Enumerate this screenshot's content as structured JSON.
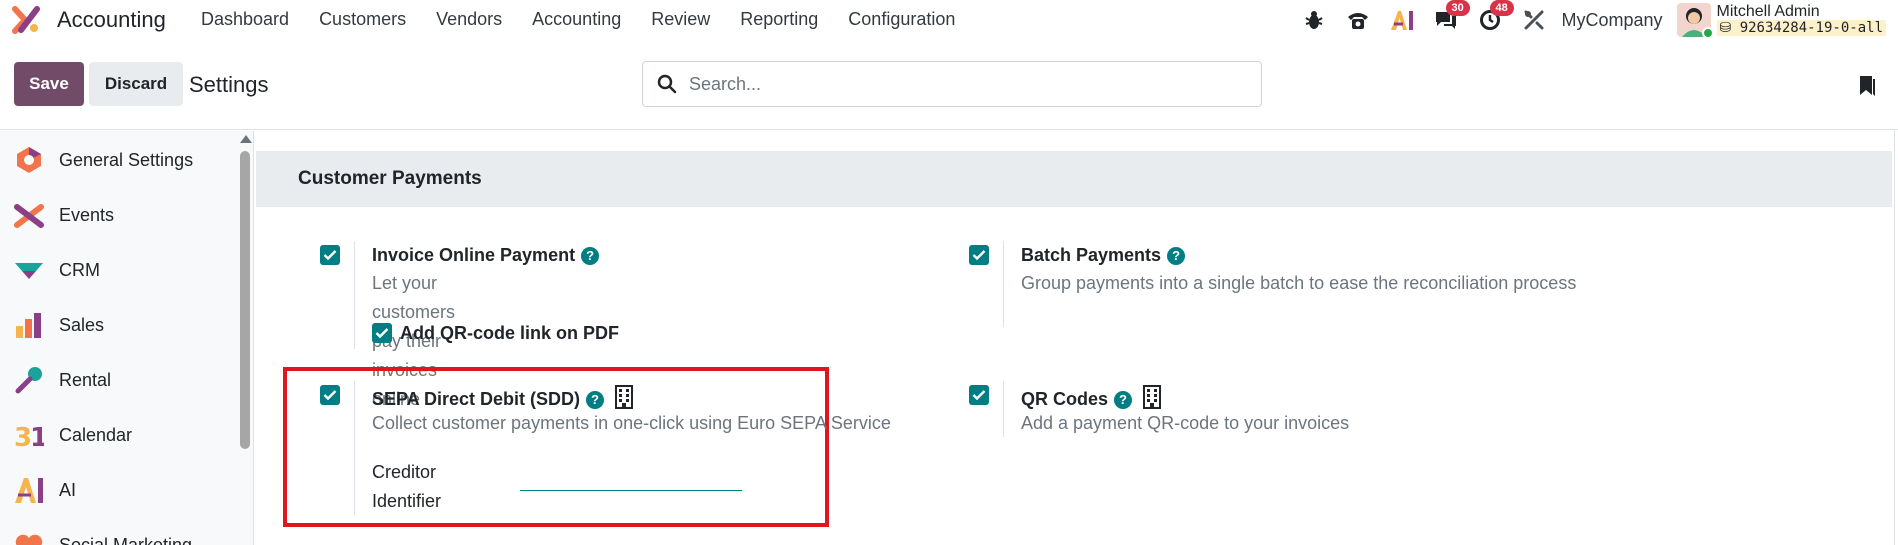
{
  "navbar": {
    "app_name": "Accounting",
    "menu": [
      "Dashboard",
      "Customers",
      "Vendors",
      "Accounting",
      "Review",
      "Reporting",
      "Configuration"
    ],
    "messages_badge": "30",
    "activities_badge": "48",
    "company": "MyCompany",
    "user_name": "Mitchell Admin",
    "database": "92634284-19-0-all"
  },
  "control_panel": {
    "save_label": "Save",
    "discard_label": "Discard",
    "breadcrumb": "Settings",
    "search_placeholder": "Search..."
  },
  "sidebar": {
    "items": [
      {
        "label": "General Settings",
        "icon": "general-settings-icon"
      },
      {
        "label": "Events",
        "icon": "events-icon"
      },
      {
        "label": "CRM",
        "icon": "crm-icon"
      },
      {
        "label": "Sales",
        "icon": "sales-icon"
      },
      {
        "label": "Rental",
        "icon": "rental-icon"
      },
      {
        "label": "Calendar",
        "icon": "calendar-icon"
      },
      {
        "label": "AI",
        "icon": "ai-icon"
      },
      {
        "label": "Social Marketing",
        "icon": "social-marketing-icon"
      }
    ]
  },
  "section": {
    "title": "Customer Payments",
    "settings": {
      "invoice_online": {
        "title": "Invoice Online Payment",
        "desc": "Let your customers pay their invoices online",
        "checked": true,
        "sub_option": "Add QR-code link on PDF"
      },
      "batch": {
        "title": "Batch Payments",
        "desc": "Group payments into a single batch to ease the reconciliation process",
        "checked": true
      },
      "sepa": {
        "title": "SEPA Direct Debit (SDD)",
        "desc": "Collect customer payments in one-click using Euro SEPA Service",
        "checked": true,
        "field_label": "Creditor Identifier",
        "field_value": ""
      },
      "qr": {
        "title": "QR Codes",
        "desc": "Add a payment QR-code to your invoices",
        "checked": true
      }
    }
  },
  "colors": {
    "brand": "#714b67",
    "accent": "#017e84",
    "badge": "#d9334a",
    "highlight": "#e0161e"
  }
}
